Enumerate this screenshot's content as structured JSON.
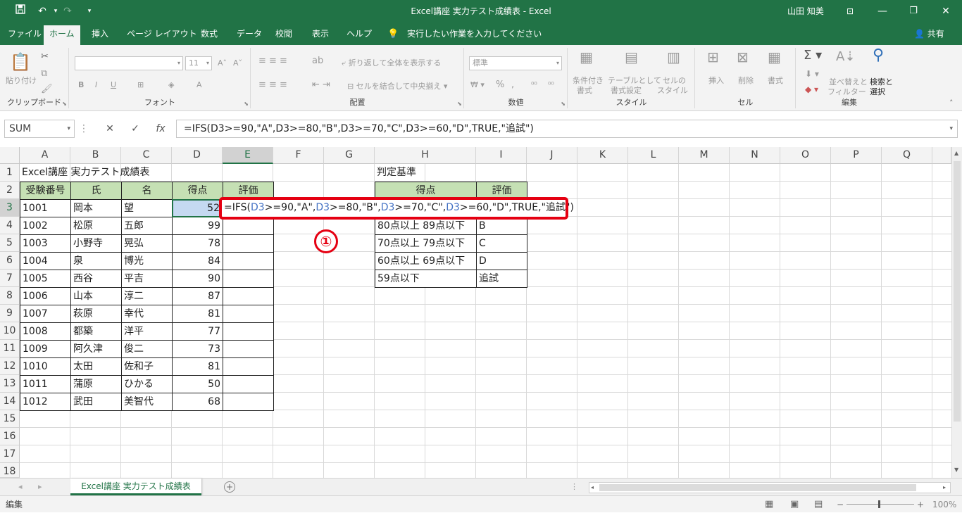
{
  "titlebar": {
    "title": "Excel講座 実力テスト成績表  -  Excel",
    "user": "山田 知美",
    "save_icon": "save-icon",
    "undo_icon": "undo-icon",
    "redo_icon": "redo-icon"
  },
  "ribbon_tabs": {
    "file": "ファイル",
    "home": "ホーム",
    "insert": "挿入",
    "page_layout": "ページ レイアウト",
    "formulas": "数式",
    "data": "データ",
    "review": "校閲",
    "view": "表示",
    "help": "ヘルプ",
    "tell_me": "実行したい作業を入力してください",
    "share": "共有"
  },
  "ribbon": {
    "clipboard": {
      "paste": "貼り付け",
      "label": "クリップボード"
    },
    "font": {
      "label": "フォント",
      "size": "11",
      "bold": "B",
      "italic": "I",
      "underline": "U"
    },
    "alignment": {
      "wrap": "折り返して全体を表示する",
      "merge": "セルを結合して中央揃え",
      "label": "配置"
    },
    "number": {
      "format": "標準",
      "label": "数値"
    },
    "styles": {
      "cond": "条件付き",
      "cond2": "書式",
      "table": "テーブルとして",
      "table2": "書式設定",
      "cell": "セルの",
      "cell2": "スタイル",
      "label": "スタイル"
    },
    "cells": {
      "insert": "挿入",
      "delete": "削除",
      "format": "書式",
      "label": "セル"
    },
    "editing": {
      "sort": "並べ替えと",
      "sort2": "フィルター",
      "find": "検索と",
      "find2": "選択",
      "label": "編集"
    }
  },
  "formula_bar": {
    "name_box": "SUM",
    "formula": "=IFS(D3>=90,\"A\",D3>=80,\"B\",D3>=70,\"C\",D3>=60,\"D\",TRUE,\"追試\")"
  },
  "columns": [
    "A",
    "B",
    "C",
    "D",
    "E",
    "F",
    "G",
    "H",
    "I",
    "J",
    "K",
    "L",
    "M",
    "N",
    "O",
    "P",
    "Q"
  ],
  "rows": [
    "1",
    "2",
    "3",
    "4",
    "5",
    "6",
    "7",
    "8",
    "9",
    "10",
    "11",
    "12",
    "13",
    "14",
    "15",
    "16",
    "17",
    "18"
  ],
  "sheet": {
    "title": "Excel講座 実力テスト成績表",
    "headers": {
      "id": "受験番号",
      "last": "氏",
      "first": "名",
      "score": "得点",
      "grade": "評価"
    },
    "students": [
      {
        "id": "1001",
        "last": "岡本",
        "first": "望",
        "score": "52"
      },
      {
        "id": "1002",
        "last": "松原",
        "first": "五郎",
        "score": "99"
      },
      {
        "id": "1003",
        "last": "小野寺",
        "first": "晃弘",
        "score": "78"
      },
      {
        "id": "1004",
        "last": "泉",
        "first": "博光",
        "score": "84"
      },
      {
        "id": "1005",
        "last": "西谷",
        "first": "平吉",
        "score": "90"
      },
      {
        "id": "1006",
        "last": "山本",
        "first": "淳二",
        "score": "87"
      },
      {
        "id": "1007",
        "last": "萩原",
        "first": "幸代",
        "score": "81"
      },
      {
        "id": "1008",
        "last": "都築",
        "first": "洋平",
        "score": "77"
      },
      {
        "id": "1009",
        "last": "阿久津",
        "first": "俊二",
        "score": "73"
      },
      {
        "id": "1010",
        "last": "太田",
        "first": "佐和子",
        "score": "81"
      },
      {
        "id": "1011",
        "last": "蒲原",
        "first": "ひかる",
        "score": "50"
      },
      {
        "id": "1012",
        "last": "武田",
        "first": "美智代",
        "score": "68"
      }
    ],
    "criteria": {
      "title": "判定基準",
      "headers": {
        "score": "得点",
        "grade": "評価"
      },
      "rows": [
        {
          "range": "80点以上 89点以下",
          "grade": "B"
        },
        {
          "range": "70点以上 79点以下",
          "grade": "C"
        },
        {
          "range": "60点以上 69点以下",
          "grade": "D"
        },
        {
          "range": "59点以下",
          "grade": "追試"
        }
      ]
    },
    "edit": {
      "p1": "=IFS(",
      "r1": "D3",
      "p2": ">=90,\"A\",",
      "r2": "D3",
      "p3": ">=80,\"B\",",
      "r3": "D3",
      "p4": ">=70,\"C\",",
      "r4": "D3",
      "p5": ">=60,\"D\",TRUE,\"追試\")"
    },
    "marker": "①"
  },
  "sheet_tabs": {
    "active": "Excel講座 実力テスト成績表",
    "add": "+"
  },
  "status": {
    "mode": "編集",
    "zoom": "100%"
  },
  "colors": {
    "excel_green": "#217346",
    "header_fill": "#c5e0b4",
    "highlight_red": "#e50012",
    "ref_blue": "#4472c4"
  }
}
